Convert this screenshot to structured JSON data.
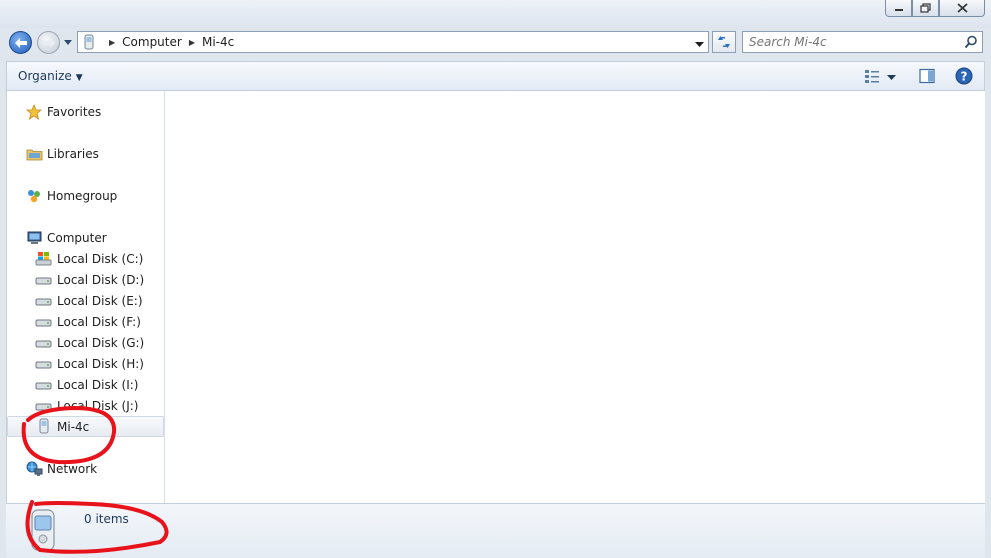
{
  "window": {
    "controls": {
      "minimize": "minimize",
      "maximize": "maximize",
      "close": "close"
    }
  },
  "address": {
    "crumbs": [
      "Computer",
      "Mi-4c"
    ]
  },
  "search": {
    "placeholder": "Search Mi-4c"
  },
  "toolbar": {
    "organize_label": "Organize"
  },
  "nav": {
    "favorites": "Favorites",
    "libraries": "Libraries",
    "homegroup": "Homegroup",
    "computer": "Computer",
    "drives": [
      "Local Disk (C:)",
      "Local Disk (D:)",
      "Local Disk (E:)",
      "Local Disk (F:)",
      "Local Disk (G:)",
      "Local Disk (H:)",
      "Local Disk (I:)",
      "Local Disk (J:)"
    ],
    "device": "Mi-4c",
    "network": "Network"
  },
  "status": {
    "item_count": "0 items"
  },
  "colors": {
    "annotation": "#e8121b",
    "accent": "#1f5ab8"
  }
}
